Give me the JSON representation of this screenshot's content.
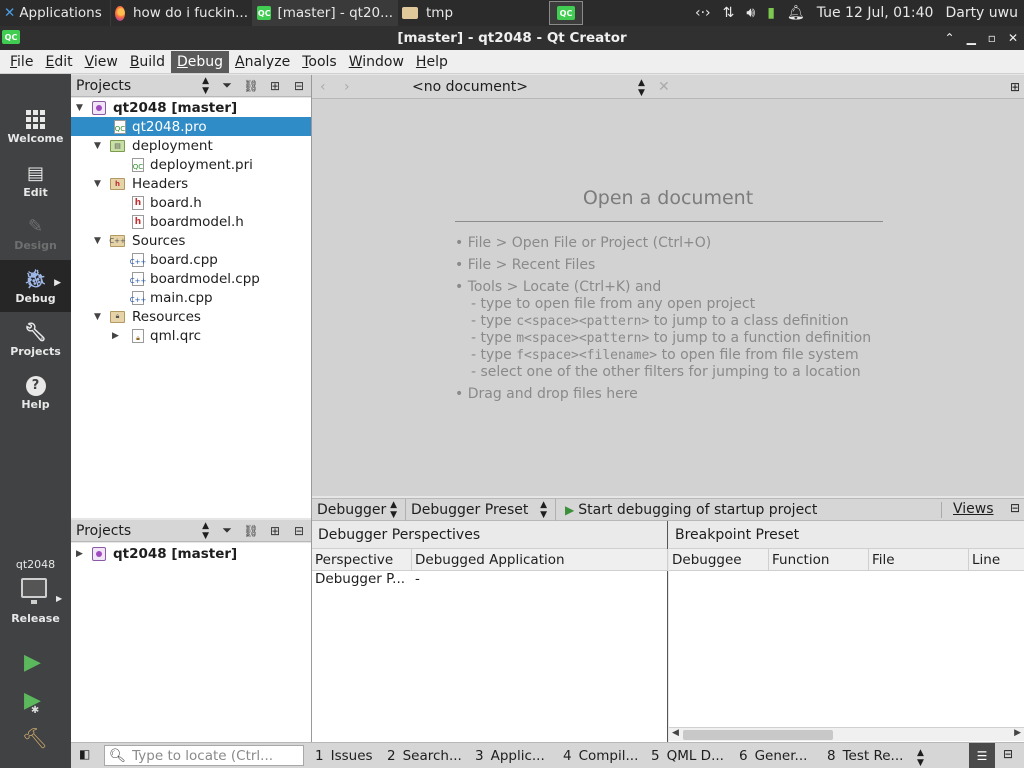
{
  "system_panel": {
    "applications_label": "Applications",
    "tasks": [
      {
        "label": "how do i fuckin...",
        "icon": "firefox-icon"
      },
      {
        "label": "[master] - qt20...",
        "icon": "qt-creator-icon"
      },
      {
        "label": "tmp",
        "icon": "folder-icon"
      }
    ],
    "workspace_label": "QC",
    "clock": "Tue 12 Jul, 01:40",
    "user": "Darty uwu"
  },
  "window": {
    "title": "[master] - qt2048 - Qt Creator",
    "icon_label": "QC"
  },
  "menubar": {
    "items": [
      "File",
      "Edit",
      "View",
      "Build",
      "Debug",
      "Analyze",
      "Tools",
      "Window",
      "Help"
    ],
    "active": "Debug"
  },
  "modes": {
    "welcome": "Welcome",
    "edit": "Edit",
    "design": "Design",
    "debug": "Debug",
    "projects": "Projects",
    "help": "Help"
  },
  "kit": {
    "project": "qt2048",
    "build_config": "Release"
  },
  "projects_pane": {
    "title": "Projects",
    "tree": [
      {
        "label": "qt2048 [master]",
        "kind": "project",
        "depth": 0,
        "expanded": true
      },
      {
        "label": "qt2048.pro",
        "kind": "pro",
        "depth": 1,
        "selected": true
      },
      {
        "label": "deployment",
        "kind": "folder",
        "depth": 1,
        "expanded": true
      },
      {
        "label": "deployment.pri",
        "kind": "pro",
        "depth": 2
      },
      {
        "label": "Headers",
        "kind": "folder",
        "depth": 1,
        "expanded": true
      },
      {
        "label": "board.h",
        "kind": "h",
        "depth": 2
      },
      {
        "label": "boardmodel.h",
        "kind": "h",
        "depth": 2
      },
      {
        "label": "Sources",
        "kind": "folder",
        "depth": 1,
        "expanded": true
      },
      {
        "label": "board.cpp",
        "kind": "cpp",
        "depth": 2
      },
      {
        "label": "boardmodel.cpp",
        "kind": "cpp",
        "depth": 2
      },
      {
        "label": "main.cpp",
        "kind": "cpp",
        "depth": 2
      },
      {
        "label": "Resources",
        "kind": "folder",
        "depth": 1,
        "expanded": true
      },
      {
        "label": "qml.qrc",
        "kind": "qrc",
        "depth": 2,
        "expanded": false
      }
    ]
  },
  "projects_pane_2": {
    "title": "Projects",
    "tree": [
      {
        "label": "qt2048 [master]",
        "kind": "project",
        "depth": 0,
        "expanded": false
      }
    ]
  },
  "editor": {
    "document_combo": "<no document>",
    "heading": "Open a document",
    "lines": [
      "• File > Open File or Project (Ctrl+O)",
      "• File > Recent Files",
      "• Tools > Locate (Ctrl+K) and"
    ],
    "sublines": [
      {
        "pre": "- type to open file from any open project",
        "code": "",
        "post": ""
      },
      {
        "pre": "- type ",
        "code": "c<space><pattern>",
        "post": " to jump to a class definition"
      },
      {
        "pre": "- type ",
        "code": "m<space><pattern>",
        "post": " to jump to a function definition"
      },
      {
        "pre": "- type ",
        "code": "f<space><filename>",
        "post": " to open file from file system"
      },
      {
        "pre": "- select one of the other filters for jumping to a location",
        "code": "",
        "post": ""
      }
    ],
    "drag_line": "• Drag and drop files here"
  },
  "debugger_toolbar": {
    "engine_combo": "Debugger",
    "preset_combo": "Debugger Preset",
    "start_label": "Start debugging of startup project",
    "views_label": "Views"
  },
  "perspectives": {
    "title": "Debugger Perspectives",
    "columns": [
      "Perspective",
      "Debugged Application"
    ],
    "rows": [
      [
        "Debugger P...",
        "-"
      ]
    ]
  },
  "breakpoints": {
    "title": "Breakpoint Preset",
    "columns": [
      "Debuggee",
      "Function",
      "File",
      "Line"
    ],
    "rows": []
  },
  "statusbar": {
    "locator_placeholder": "Type to locate (Ctrl...",
    "tabs": [
      {
        "num": "1",
        "label": "Issues"
      },
      {
        "num": "2",
        "label": "Search..."
      },
      {
        "num": "3",
        "label": "Applic..."
      },
      {
        "num": "4",
        "label": "Compil..."
      },
      {
        "num": "5",
        "label": "QML D..."
      },
      {
        "num": "6",
        "label": "Gener..."
      },
      {
        "num": "8",
        "label": "Test Re..."
      }
    ]
  },
  "colors": {
    "selection": "#308cc6",
    "modebar": "#404244",
    "qt_green": "#41cd52"
  }
}
